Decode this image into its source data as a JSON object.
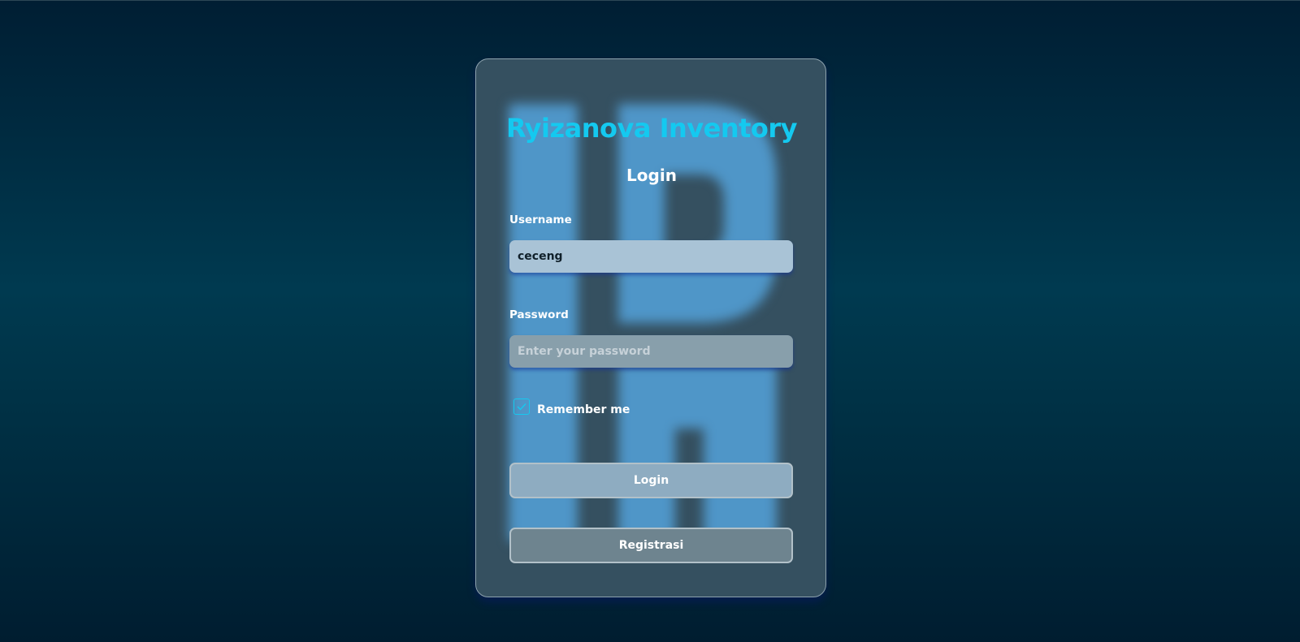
{
  "app_title": "Ryizanova Inventory",
  "form_title": "Login",
  "username": {
    "label": "Username",
    "value": "ceceng"
  },
  "password": {
    "label": "Password",
    "placeholder": "Enter your password",
    "value": ""
  },
  "remember": {
    "label": "Remember me",
    "checked": true
  },
  "buttons": {
    "login_label": "Login",
    "register_label": "Registrasi"
  },
  "colors": {
    "accent": "#14c9f0",
    "card": "#355060",
    "watermark": "#4f96c8"
  },
  "icons": {
    "check": "check-icon"
  }
}
